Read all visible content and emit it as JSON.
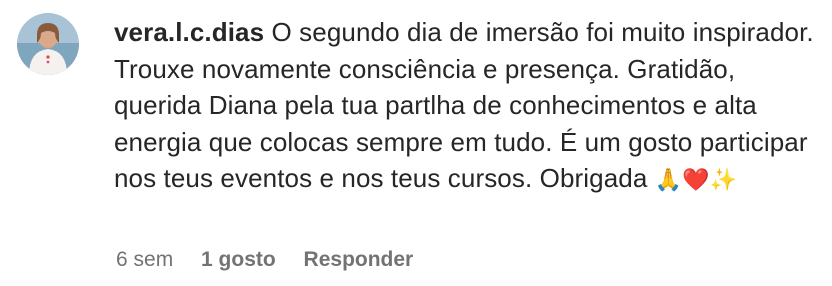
{
  "comment": {
    "username": "vera.l.c.dias",
    "text": "O segundo dia de imersão foi muito inspirador. Trouxe novamente consciência e presença. Gratidão, querida Diana pela tua partlha de conhecimentos e alta energia que colocas sempre em tudo. É um gosto participar nos teus eventos e nos teus cursos. Obrigada",
    "emojis": "🙏❤️✨",
    "timestamp": "6 sem",
    "likes": "1 gosto",
    "reply_label": "Responder"
  },
  "colors": {
    "text": "#262626",
    "secondary": "#737373"
  }
}
